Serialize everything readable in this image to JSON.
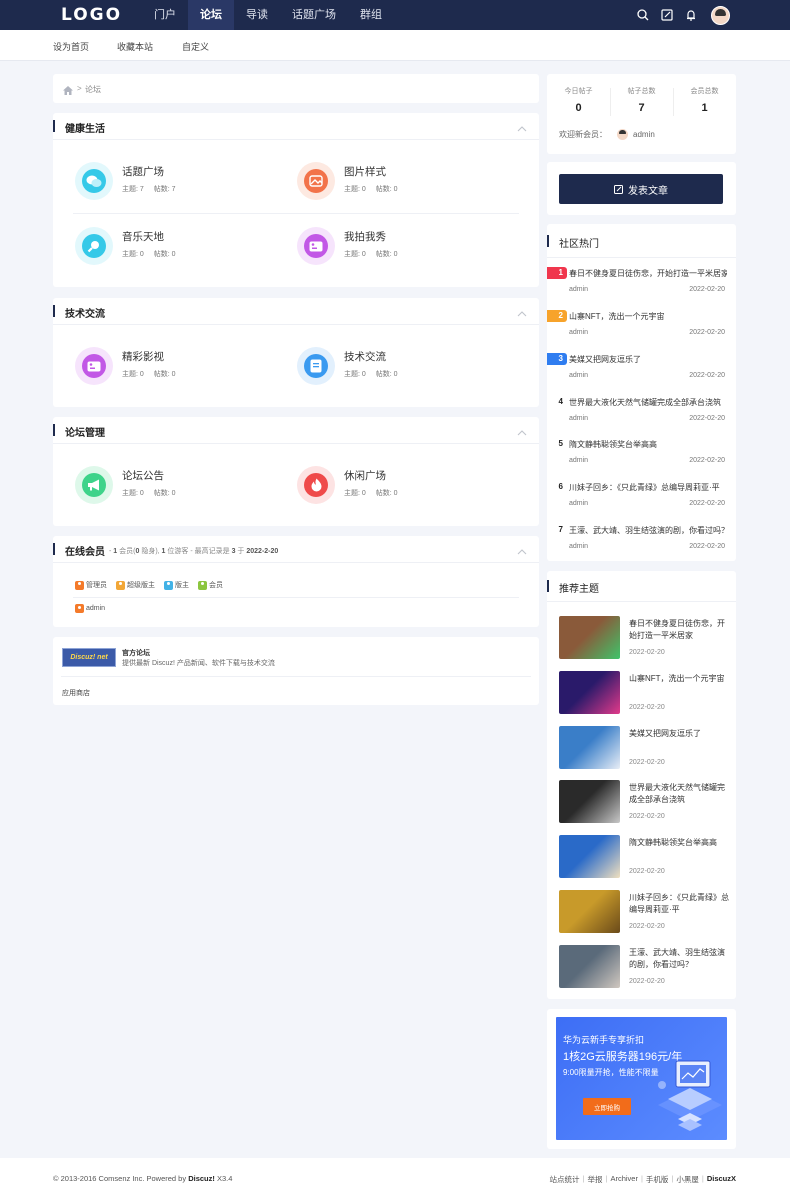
{
  "header": {
    "logo": "LOGO",
    "nav": [
      "门户",
      "论坛",
      "导读",
      "话题广场",
      "群组"
    ],
    "active_nav": "论坛"
  },
  "subnav": [
    "设为首页",
    "收藏本站",
    "自定义"
  ],
  "breadcrumb": {
    "current": "论坛",
    "separator": ">"
  },
  "sections": [
    {
      "title": "健康生活",
      "forums": [
        {
          "name": "话题广场",
          "topics": "主题: 7",
          "posts": "帖数: 7",
          "icon": "chat-bubbles-icon",
          "color": "#35c9e8"
        },
        {
          "name": "图片样式",
          "topics": "主题: 0",
          "posts": "帖数: 0",
          "icon": "image-icon",
          "color": "#f2734a"
        },
        {
          "name": "音乐天地",
          "topics": "主题: 0",
          "posts": "帖数: 0",
          "icon": "search-icon",
          "color": "#35c9e8"
        },
        {
          "name": "我拍我秀",
          "topics": "主题: 0",
          "posts": "帖数: 0",
          "icon": "video-camera-icon",
          "color": "#c258e6"
        }
      ]
    },
    {
      "title": "技术交流",
      "forums": [
        {
          "name": "精彩影视",
          "topics": "主题: 0",
          "posts": "帖数: 0",
          "icon": "video-camera-icon",
          "color": "#c258e6"
        },
        {
          "name": "技术交流",
          "topics": "主题: 0",
          "posts": "帖数: 0",
          "icon": "document-icon",
          "color": "#3a9af0"
        }
      ]
    },
    {
      "title": "论坛管理",
      "forums": [
        {
          "name": "论坛公告",
          "topics": "主题: 0",
          "posts": "帖数: 0",
          "icon": "megaphone-icon",
          "color": "#3ed38a"
        },
        {
          "name": "休闲广场",
          "topics": "主题: 0",
          "posts": "帖数: 0",
          "icon": "flame-icon",
          "color": "#ef4a4a"
        }
      ]
    }
  ],
  "online": {
    "title": "在线会员",
    "pre": "- ",
    "n1": "1",
    "t1": " 会员(",
    "n2": "0",
    "t2": " 隐身), ",
    "n3": "1",
    "t3": " 位游客 - 最高记录是 ",
    "n4": "3",
    "t4": " 于 ",
    "date": "2022-2-20",
    "legend": [
      {
        "label": "管理员",
        "color": "#f47a2a"
      },
      {
        "label": "超级版主",
        "color": "#f2a737"
      },
      {
        "label": "版主",
        "color": "#42b2e6"
      },
      {
        "label": "会员",
        "color": "#8cc63f"
      }
    ],
    "member": "admin"
  },
  "links": {
    "badge": "Discuz! net",
    "title": "官方论坛",
    "desc": "提供最新 Discuz! 产品新闻、软件下载与技术交流",
    "app": "应用商店"
  },
  "stats": {
    "today_label": "今日帖子",
    "today": "0",
    "posts_label": "帖子总数",
    "posts": "7",
    "members_label": "会员总数",
    "members": "1",
    "welcome": "欢迎新会员：",
    "newest": "admin"
  },
  "post_button": "发表文章",
  "hot": {
    "title": "社区热门",
    "items": [
      {
        "rank": "1",
        "title": "春日不健身夏日徒伤悲，开始打造一平米居家",
        "author": "admin",
        "date": "2022-02-20"
      },
      {
        "rank": "2",
        "title": "山寨NFT，洗出一个元宇宙",
        "author": "admin",
        "date": "2022-02-20"
      },
      {
        "rank": "3",
        "title": "美媒又把网友逗乐了",
        "author": "admin",
        "date": "2022-02-20"
      },
      {
        "rank": "4",
        "title": "世界最大液化天然气储罐完成全部承台浇筑",
        "author": "admin",
        "date": "2022-02-20"
      },
      {
        "rank": "5",
        "title": "隋文静韩聪领奖台举高高",
        "author": "admin",
        "date": "2022-02-20"
      },
      {
        "rank": "6",
        "title": "川妹子回乡：《只此青绿》总编导周莉亚·平",
        "author": "admin",
        "date": "2022-02-20"
      },
      {
        "rank": "7",
        "title": "王濛、武大靖、羽生结弦演的剧，你看过吗？",
        "author": "admin",
        "date": "2022-02-20"
      }
    ]
  },
  "rec": {
    "title": "推荐主题",
    "items": [
      {
        "title": "春日不健身夏日徒伤悲，开始打造一平米居家",
        "date": "2022-02-20",
        "c1": "#8a5a3a",
        "c2": "#3fc46a"
      },
      {
        "title": "山寨NFT，洗出一个元宇宙",
        "date": "2022-02-20",
        "c1": "#2a1a6a",
        "c2": "#e23a8a"
      },
      {
        "title": "美媒又把网友逗乐了",
        "date": "2022-02-20",
        "c1": "#3a7ec8",
        "c2": "#e8eef6"
      },
      {
        "title": "世界最大液化天然气储罐完成全部承台浇筑",
        "date": "2022-02-20",
        "c1": "#2a2a2a",
        "c2": "#c8c8c8"
      },
      {
        "title": "隋文静韩聪领奖台举高高",
        "date": "2022-02-20",
        "c1": "#2a6ac8",
        "c2": "#f0e0c0"
      },
      {
        "title": "川妹子回乡：《只此青绿》总编导周莉亚·平",
        "date": "2022-02-20",
        "c1": "#c89a2a",
        "c2": "#6a4a1a"
      },
      {
        "title": "王濛、武大靖、羽生结弦演的剧，你看过吗？",
        "date": "2022-02-20",
        "c1": "#5a6a7a",
        "c2": "#d0c8c0"
      }
    ]
  },
  "ad": {
    "line1": "华为云新手专享折扣",
    "line2": "1核2G云服务器196元/年",
    "line3": "9:00限量开抢，性能不限量",
    "button": "立即抢购"
  },
  "footer": {
    "copyright": "© 2013-2016 Comsenz Inc. Powered by ",
    "brand": "Discuz!",
    "version": " X3.4",
    "links": [
      "站点统计",
      "举报",
      "Archiver",
      "手机版",
      "小黑屋"
    ],
    "brand_right": "DiscuzX"
  }
}
